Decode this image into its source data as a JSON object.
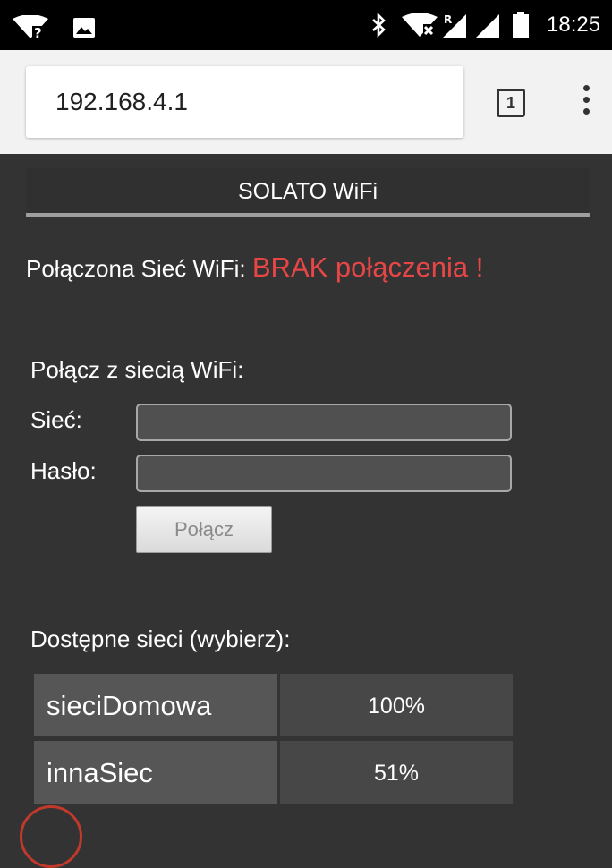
{
  "status_bar": {
    "time": "18:25",
    "signal_badge": "R",
    "icons": [
      "wifi-question-icon",
      "image-icon",
      "bluetooth-icon",
      "wifi-no-internet-icon",
      "signal-roaming-icon",
      "signal-icon",
      "battery-icon"
    ]
  },
  "browser": {
    "url": "192.168.4.1",
    "tab_count": "1",
    "menu_icon": "more-vert-icon"
  },
  "page": {
    "title": "SOLATO WiFi",
    "connection_label": "Połączona Sieć WiFi: ",
    "connection_status": "BRAK połączenia !",
    "connect_heading": "Połącz z siecią WiFi:",
    "network_label": "Sieć:",
    "network_value": "",
    "password_label": "Hasło:",
    "password_value": "",
    "connect_button": "Połącz",
    "networks_heading": "Dostępne sieci (wybierz):",
    "networks": [
      {
        "name": "sieciDomowa",
        "signal": "100%"
      },
      {
        "name": "innaSiec",
        "signal": "51%"
      }
    ]
  },
  "colors": {
    "page_background": "#333333",
    "error_text": "#e84646",
    "browser_toolbar": "#f2f2f2"
  }
}
